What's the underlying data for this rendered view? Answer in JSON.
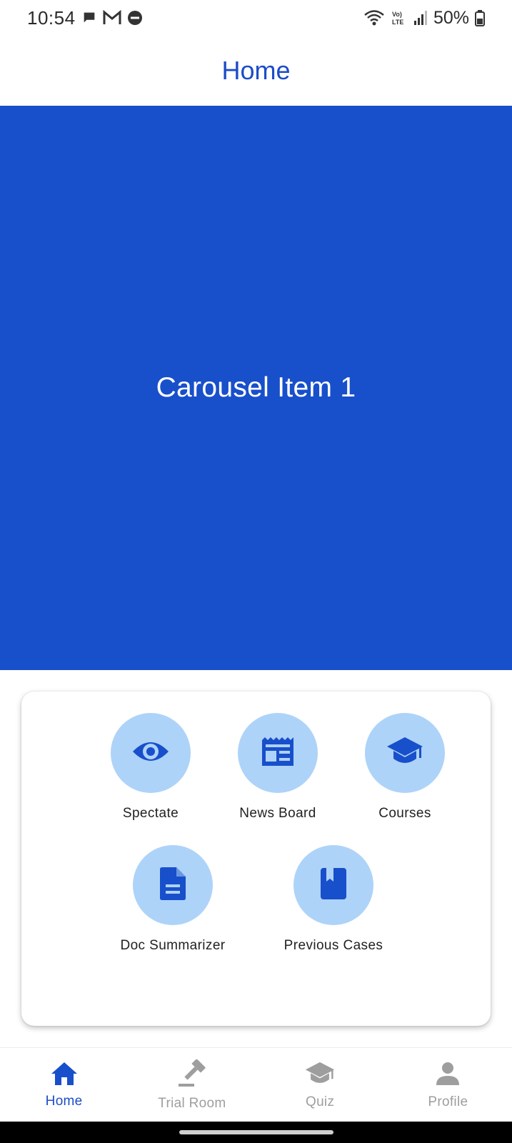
{
  "status_bar": {
    "time": "10:54",
    "battery": "50%",
    "icons_left": [
      "chat-icon",
      "gmail-icon",
      "dnd-icon"
    ],
    "icons_right": [
      "wifi-icon",
      "volte-icon",
      "signal-icon",
      "battery-icon"
    ]
  },
  "app_bar": {
    "title": "Home"
  },
  "carousel": {
    "label": "Carousel Item 1",
    "color": "#184fcb"
  },
  "menu": {
    "items": [
      {
        "label": "Spectate",
        "icon": "eye-icon"
      },
      {
        "label": "News Board",
        "icon": "newspaper-icon"
      },
      {
        "label": "Courses",
        "icon": "graduation-cap-icon"
      },
      {
        "label": "Doc Summarizer",
        "icon": "document-icon"
      },
      {
        "label": "Previous Cases",
        "icon": "book-icon"
      }
    ]
  },
  "bottom_nav": {
    "items": [
      {
        "label": "Home",
        "icon": "home-icon",
        "active": true
      },
      {
        "label": "Trial Room",
        "icon": "gavel-icon",
        "active": false
      },
      {
        "label": "Quiz",
        "icon": "school-icon",
        "active": false
      },
      {
        "label": "Profile",
        "icon": "person-icon",
        "active": false
      }
    ]
  },
  "colors": {
    "accent": "#1c4dc7",
    "icon_circle": "#aed3f8",
    "inactive": "#9e9e9e"
  }
}
